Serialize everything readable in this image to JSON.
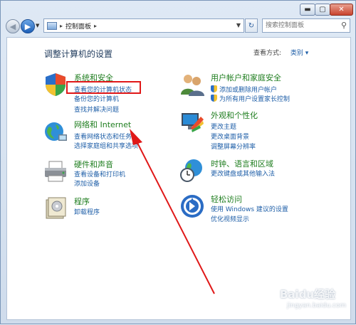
{
  "window_controls": {
    "minimize": "▬",
    "maximize": "▢",
    "close": "✕"
  },
  "nav": {
    "back_glyph": "◀",
    "forward_glyph": "▶",
    "dropdown_glyph": "▼"
  },
  "address": {
    "separator_before": "▸",
    "path": "控制面板",
    "separator_after": "▸",
    "dropdown_glyph": "▼"
  },
  "refresh_glyph": "↻",
  "search": {
    "placeholder": "搜索控制面板",
    "icon": "search-icon"
  },
  "main": {
    "heading": "调整计算机的设置",
    "view_by_label": "查看方式:",
    "view_by_value": "类别 ▾"
  },
  "categories_left": [
    {
      "title": "系统和安全",
      "icon": "shield-security-icon",
      "links": [
        "查看您的计算机状态",
        "备份您的计算机",
        "查找并解决问题"
      ]
    },
    {
      "title": "网络和 Internet",
      "icon": "network-globe-icon",
      "links": [
        "查看网络状态和任务",
        "选择家庭组和共享选项"
      ]
    },
    {
      "title": "硬件和声音",
      "icon": "printer-icon",
      "links": [
        "查看设备和打印机",
        "添加设备"
      ]
    },
    {
      "title": "程序",
      "icon": "programs-icon",
      "links": [
        "卸载程序"
      ]
    }
  ],
  "categories_right": [
    {
      "title": "用户帐户和家庭安全",
      "icon": "users-icon",
      "links": [
        "添加或删除用户帐户",
        "为所有用户设置家长控制"
      ]
    },
    {
      "title": "外观和个性化",
      "icon": "appearance-icon",
      "links": [
        "更改主题",
        "更改桌面背景",
        "调整屏幕分辨率"
      ]
    },
    {
      "title": "时钟、语言和区域",
      "icon": "clock-globe-icon",
      "links": [
        "更改键盘或其他输入法"
      ]
    },
    {
      "title": "轻松访问",
      "icon": "ease-of-access-icon",
      "links": [
        "使用 Windows 建议的设置",
        "优化视频显示"
      ]
    }
  ],
  "watermark": {
    "brand": "Baidu经验",
    "url": "jingyan.baidu.com"
  },
  "colors": {
    "title_green": "#1e7d1e",
    "link_blue": "#1f5fa8",
    "highlight_red": "#e01818"
  }
}
